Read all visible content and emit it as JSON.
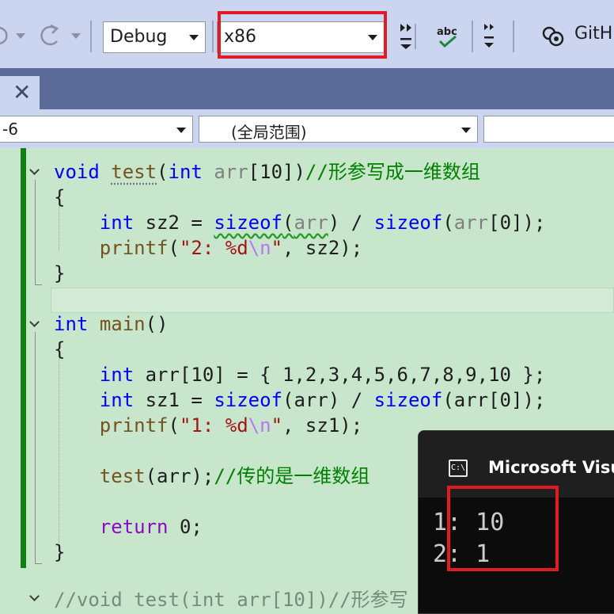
{
  "toolbar": {
    "config_value": "Debug",
    "platform_value": "x86",
    "github_label": "GitH",
    "colors": {
      "highlight": "#e11b24",
      "toolbar_bg": "#ccd5f0"
    }
  },
  "tab": {
    "close_glyph": "✕"
  },
  "navbar": {
    "project_value": "-6",
    "scope_value": "(全局范围)",
    "member_value": ""
  },
  "code": {
    "l1_kw": "void",
    "l1_fn": "test",
    "l1_ptype": "int",
    "l1_param": "arr",
    "l1_idx": "[10])",
    "l1_comment": "//形参写成一维数组",
    "l2": "{",
    "l3_kw": "int",
    "l3_var": " sz2 = ",
    "l3_sizeof1": "sizeof",
    "l3_paren1": "(",
    "l3_arr1": "arr",
    "l3_rest1": ") / ",
    "l3_sizeof2": "sizeof",
    "l3_paren2": "(",
    "l3_arr2": "arr",
    "l3_rest2": "[0]);",
    "l4_fn": "printf",
    "l4_open": "(",
    "l4_str": "\"2: %d",
    "l4_esc": "\\n",
    "l4_strend": "\"",
    "l4_rest": ", sz2);",
    "l5": "}",
    "l7_kw": "int",
    "l7_fn": "main",
    "l7_rest": "()",
    "l8": "{",
    "l9_kw": "int",
    "l9_rest": " arr[10] = { 1,2,3,4,5,6,7,8,9,10 };",
    "l10_kw": "int",
    "l10_var": " sz1 = ",
    "l10_sizeof1": "sizeof",
    "l10_arr1": "(arr) / ",
    "l10_sizeof2": "sizeof",
    "l10_rest": "(arr[0]);",
    "l11_fn": "printf",
    "l11_open": "(",
    "l11_str": "\"1: %d",
    "l11_esc": "\\n",
    "l11_strend": "\"",
    "l11_rest": ", sz1);",
    "l13_fn": "test",
    "l13_open": "(",
    "l13_arr": "arr",
    "l13_close": ");",
    "l13_comment": "//传的是一维数组",
    "l15_kw": "return",
    "l15_rest": " 0;",
    "l16": "}",
    "l18_faded": "//void test(int arr[10])//形参写"
  },
  "console": {
    "title": "Microsoft Visu",
    "icon_text": "C:\\",
    "line1": "1: 10",
    "line2": "2: 1"
  }
}
